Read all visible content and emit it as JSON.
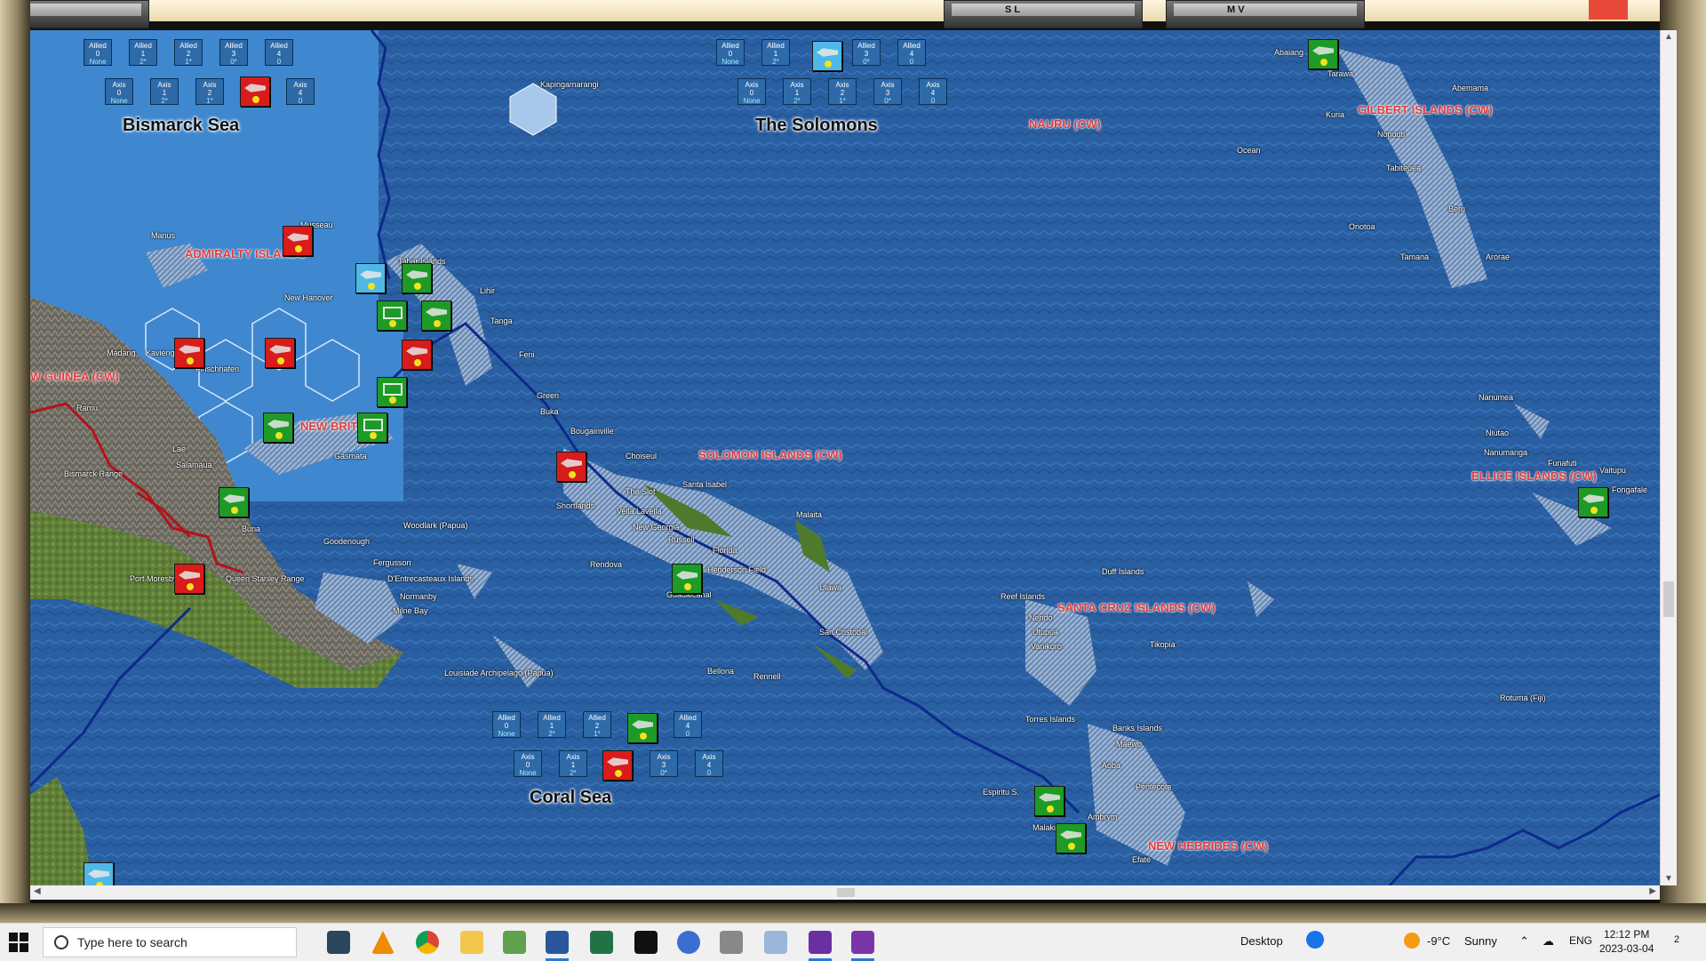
{
  "windows": {
    "sl": "S L",
    "mv": "M V"
  },
  "seas": {
    "bismarck": "Bismarck Sea",
    "solomons": "The Solomons",
    "coral": "Coral Sea"
  },
  "sea_boxes": {
    "bismarck_allied": [
      {
        "l1": "Allied",
        "l2": "0",
        "l3": "None"
      },
      {
        "l1": "Allied",
        "l2": "1",
        "l3": "2*"
      },
      {
        "l1": "Allied",
        "l2": "2",
        "l3": "1*"
      },
      {
        "l1": "Allied",
        "l2": "3",
        "l3": "0*"
      },
      {
        "l1": "Allied",
        "l2": "4",
        "l3": "0"
      }
    ],
    "bismarck_axis": [
      {
        "l1": "Axis",
        "l2": "0",
        "l3": "None"
      },
      {
        "l1": "Axis",
        "l2": "1",
        "l3": "2*"
      },
      {
        "l1": "Axis",
        "l2": "2",
        "l3": "1*"
      },
      {
        "l1": "",
        "l2": "",
        "l3": ""
      },
      {
        "l1": "Axis",
        "l2": "4",
        "l3": "0"
      }
    ],
    "solomons_allied": [
      {
        "l1": "Allied",
        "l2": "0",
        "l3": "None"
      },
      {
        "l1": "Allied",
        "l2": "1",
        "l3": "2*"
      },
      {
        "l1": "",
        "l2": "",
        "l3": ""
      },
      {
        "l1": "Allied",
        "l2": "3",
        "l3": "0*"
      },
      {
        "l1": "Allied",
        "l2": "4",
        "l3": "0"
      }
    ],
    "solomons_axis": [
      {
        "l1": "Axis",
        "l2": "0",
        "l3": "None"
      },
      {
        "l1": "Axis",
        "l2": "1",
        "l3": "2*"
      },
      {
        "l1": "Axis",
        "l2": "2",
        "l3": "1*"
      },
      {
        "l1": "Axis",
        "l2": "3",
        "l3": "0*"
      },
      {
        "l1": "Axis",
        "l2": "4",
        "l3": "0"
      }
    ],
    "coral_allied": [
      {
        "l1": "Allied",
        "l2": "0",
        "l3": "None"
      },
      {
        "l1": "Allied",
        "l2": "1",
        "l3": "2*"
      },
      {
        "l1": "Allied",
        "l2": "2",
        "l3": "1*"
      },
      {
        "l1": "",
        "l2": "",
        "l3": ""
      },
      {
        "l1": "Allied",
        "l2": "4",
        "l3": "0"
      }
    ],
    "coral_axis": [
      {
        "l1": "Axis",
        "l2": "0",
        "l3": "None"
      },
      {
        "l1": "Axis",
        "l2": "1",
        "l3": "2*"
      },
      {
        "l1": "",
        "l2": "",
        "l3": ""
      },
      {
        "l1": "Axis",
        "l2": "3",
        "l3": "0*"
      },
      {
        "l1": "Axis",
        "l2": "4",
        "l3": "0"
      }
    ]
  },
  "regions": {
    "admiralty": "ADMIRALTY ISLANDS",
    "new_guinea": "W GUINEA (CW)",
    "new_britain": "NEW BRITAIN",
    "solomon_islands": "SOLOMON ISLANDS (CW)",
    "nauru": "NAURU (CW)",
    "gilbert": "GILBERT ISLANDS (CW)",
    "ellice": "ELLICE ISLANDS (CW)",
    "santa_cruz": "SANTA CRUZ ISLANDS (CW)",
    "new_hebrides": "NEW HEBRIDES (CW)"
  },
  "places": [
    "Kapingamarangi",
    "Musseau",
    "Manus",
    "Tabar Islands",
    "New Hanover",
    "Lihir",
    "Tanga",
    "Feni",
    "Green",
    "Buka",
    "Bougainville",
    "Choiseul",
    "Santa Isabel",
    "Malaita",
    "The Slot",
    "Shortlands",
    "Vella Lavella",
    "New Georgia",
    "Russell",
    "Florida",
    "Henderson Field",
    "Guadalcanal",
    "Rendova",
    "Ulawa",
    "San Cristobal",
    "Rennell",
    "Bellona",
    "Madang",
    "Kavieng",
    "Finschhafen",
    "Ramu",
    "Lae",
    "Salamaua",
    "Bismarck Range",
    "Buna",
    "Gasmata",
    "Woodlark (Papua)",
    "Goodenough",
    "Fergusson",
    "D'Entrecasteaux Islands",
    "Normanby",
    "Milne Bay",
    "Port Moresby",
    "Queen Stanley Range",
    "Louisiade Archipelago (Papua)",
    "Ocean",
    "Abemama",
    "Tarawa",
    "Abaiang",
    "Kuria",
    "Nonouti",
    "Tabiteuea",
    "Beru",
    "Onotoa",
    "Tamana",
    "Arorae",
    "Nanumea",
    "Niutao",
    "Nanumanga",
    "Funafuti",
    "Vaitupu",
    "Fongafale",
    "Reef Islands",
    "Nendo",
    "Utupua",
    "Vanikoro",
    "Duff Islands",
    "Tikopia",
    "Rotuma (Fiji)",
    "Torres Islands",
    "Banks Islands",
    "Maewo",
    "Aoba",
    "Pentecote",
    "Espiritu S.",
    "Malakula",
    "Ambrym",
    "Efate"
  ],
  "taskbar": {
    "search_placeholder": "Type here to search",
    "desktop": "Desktop",
    "weather_temp": "-9°C",
    "weather_desc": "Sunny",
    "lang": "ENG",
    "time": "12:12 PM",
    "date": "2023-03-04",
    "notif_count": "2"
  },
  "colors": {
    "allied_unit": "#1e9a27",
    "axis_unit": "#d81b1b",
    "navy_unit": "#4fb8e6",
    "ocean": "#2a5fa2",
    "region_label": "#e23c3c"
  }
}
